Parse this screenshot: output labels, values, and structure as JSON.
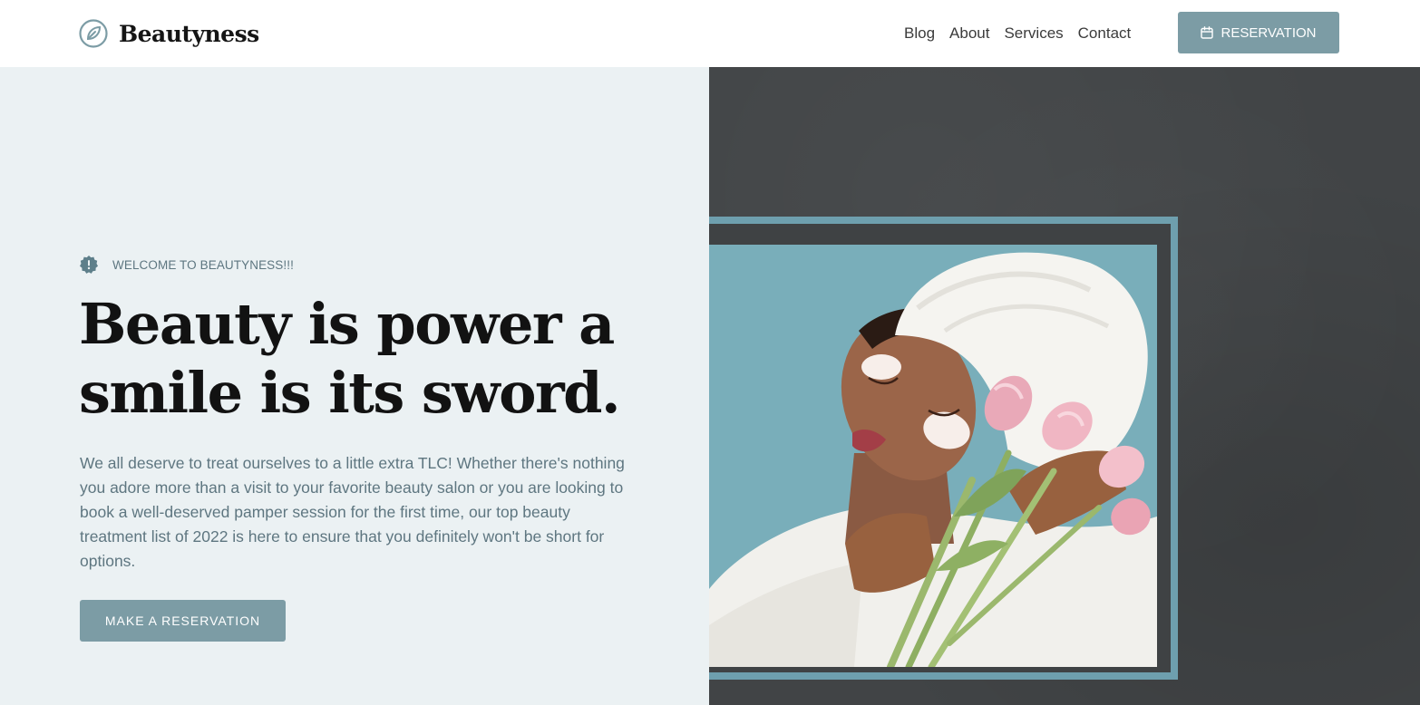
{
  "brand": {
    "name": "Beautyness",
    "logo_icon": "leaf-circle-icon"
  },
  "nav": {
    "items": [
      {
        "label": "Blog"
      },
      {
        "label": "About"
      },
      {
        "label": "Services"
      },
      {
        "label": "Contact"
      }
    ]
  },
  "header": {
    "reservation_label": "RESERVATION",
    "reservation_icon": "calendar-icon"
  },
  "hero": {
    "welcome_icon": "badge-alert-icon",
    "welcome_text": "WELCOME TO BEAUTYNESS!!!",
    "headline": "Beauty is power a smile is its sword.",
    "description": "We all deserve to treat ourselves to a little extra TLC! Whether there's nothing you adore more than a visit to your favorite beauty salon or you are looking to book a well-deserved pamper session for the first time, our top beauty treatment list of 2022 is here to ensure that you definitely won't be short for options.",
    "cta_label": "MAKE A RESERVATION"
  },
  "colors": {
    "accent": "#7c9ca5",
    "hero_bg": "#ebf1f3",
    "dark_bg": "#414446",
    "frame": "#6e9fae",
    "text_muted": "#5e7680"
  }
}
